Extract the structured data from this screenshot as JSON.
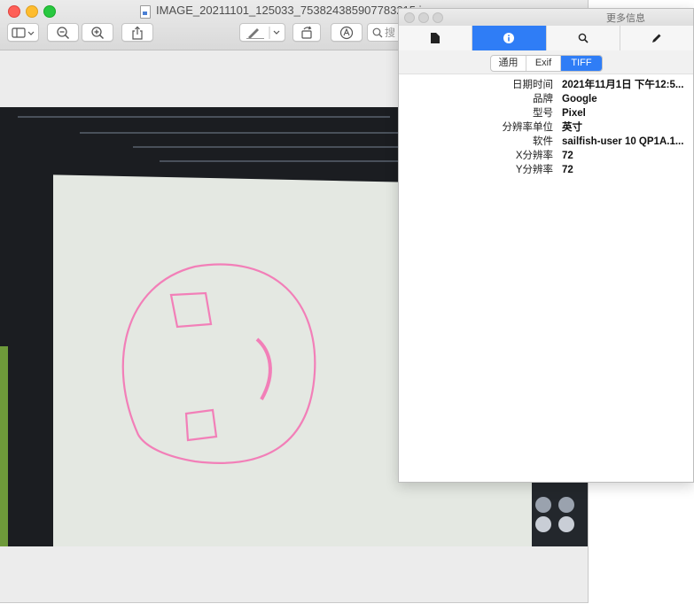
{
  "window": {
    "title": "IMAGE_20211101_125033_753824385907783215.jpg"
  },
  "toolbar": {
    "search_placeholder": "搜"
  },
  "info_panel": {
    "title": "更多信息",
    "subtabs": [
      "通用",
      "Exif",
      "TIFF"
    ],
    "active_subtab": "TIFF",
    "rows": [
      {
        "key": "日期时间",
        "value": "2021年11月1日 下午12:5..."
      },
      {
        "key": "品牌",
        "value": "Google"
      },
      {
        "key": "型号",
        "value": "Pixel"
      },
      {
        "key": "分辨率单位",
        "value": "英寸"
      },
      {
        "key": "软件",
        "value": "sailfish-user 10 QP1A.1..."
      },
      {
        "key": "X分辨率",
        "value": "72"
      },
      {
        "key": "Y分辨率",
        "value": "72"
      }
    ]
  },
  "colors": {
    "accent": "#2f7df6",
    "drawing": "#f27fb8"
  }
}
